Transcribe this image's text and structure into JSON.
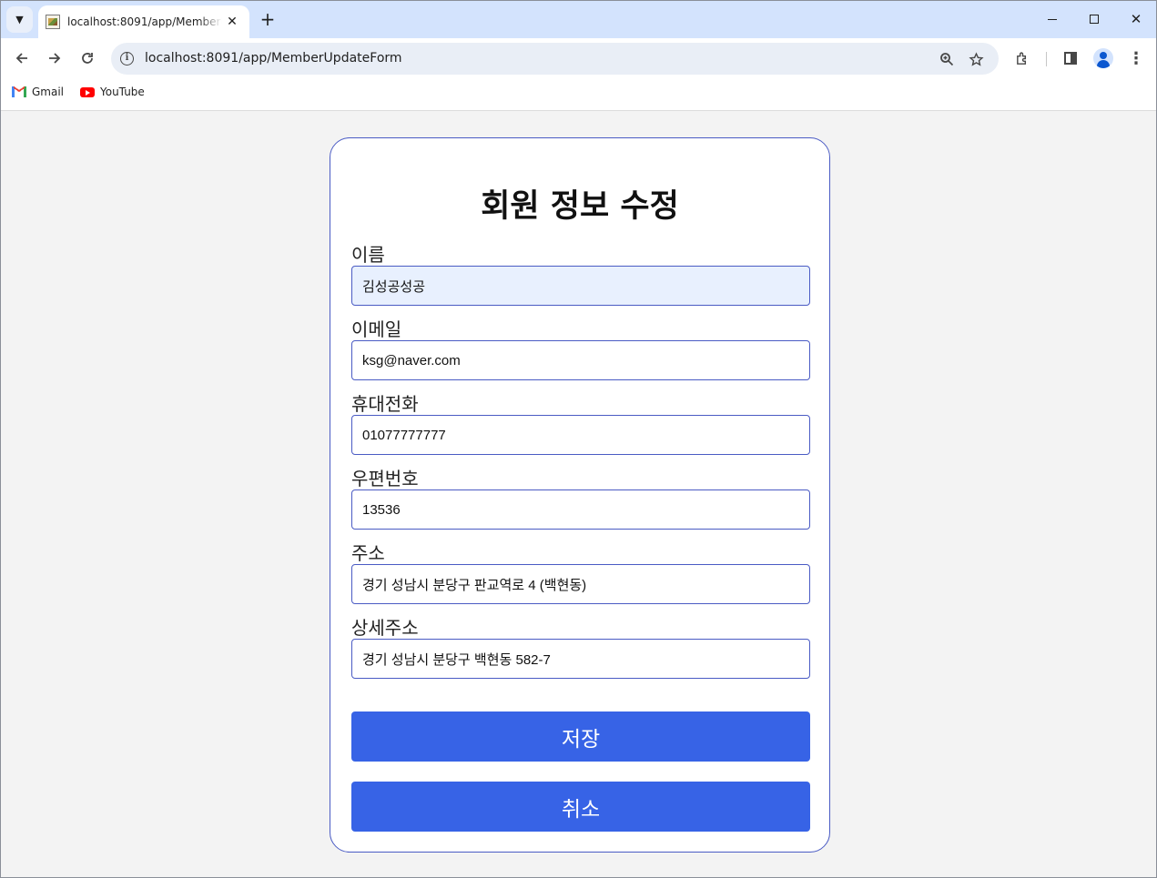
{
  "browser": {
    "tab_title": "localhost:8091/app/MemberUpdateForm",
    "url": "localhost:8091/app/MemberUpdateForm",
    "bookmarks": [
      {
        "label": "Gmail",
        "icon": "gmail-icon"
      },
      {
        "label": "YouTube",
        "icon": "youtube-icon"
      }
    ]
  },
  "form": {
    "title": "회원 정보 수정",
    "fields": [
      {
        "label": "이름",
        "value": "김성공성공",
        "autofilled": true
      },
      {
        "label": "이메일",
        "value": "ksg@naver.com",
        "autofilled": false
      },
      {
        "label": "휴대전화",
        "value": "01077777777",
        "autofilled": false
      },
      {
        "label": "우편번호",
        "value": "13536",
        "autofilled": false
      },
      {
        "label": "주소",
        "value": "경기 성남시 분당구 판교역로 4 (백현동)",
        "autofilled": false
      },
      {
        "label": "상세주소",
        "value": "경기 성남시 분당구 백현동 582-7",
        "autofilled": false
      }
    ],
    "save_label": "저장",
    "cancel_label": "취소"
  },
  "colors": {
    "accent": "#3763e6",
    "card_border": "#4a5bc4",
    "tabstrip": "#d3e3fd",
    "autofill_bg": "#e8f0fe"
  }
}
